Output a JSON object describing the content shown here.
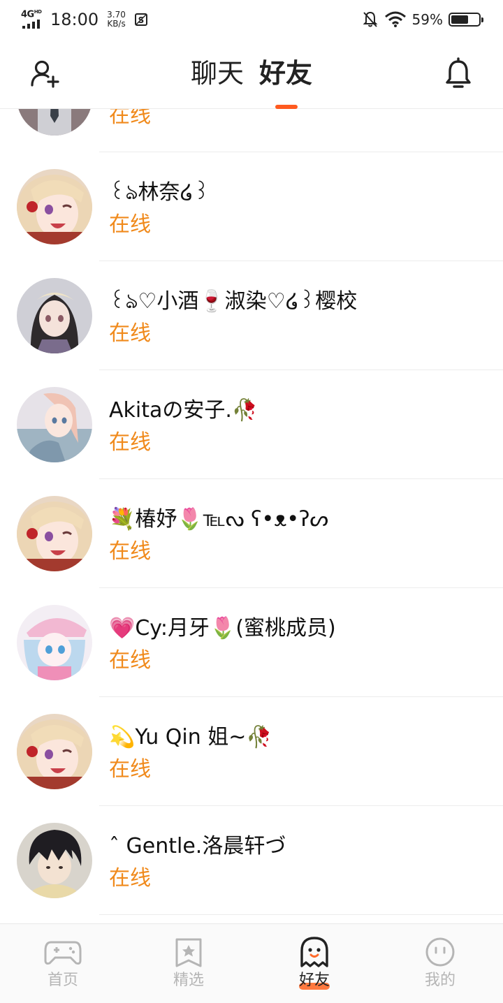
{
  "status_bar": {
    "network_type": "4G",
    "network_sup": "HD",
    "time": "18:00",
    "speed_value": "3.70",
    "speed_unit": "KB/s",
    "battery_percent": "59%",
    "battery_level": 0.59
  },
  "header": {
    "tabs": [
      {
        "label": "聊天",
        "active": false
      },
      {
        "label": "好友",
        "active": true
      }
    ],
    "accent_color": "#ff5a1f"
  },
  "friends": [
    {
      "name": "",
      "status": "在线",
      "avatar": "avatar-dark-outfit"
    },
    {
      "name": "꒰ঌ林奈໒꒱",
      "status": "在线",
      "avatar": "avatar-blonde-girl"
    },
    {
      "name": "꒰ঌ♡小酒🍷淑染♡໒꒱樱校",
      "status": "在线",
      "avatar": "avatar-dark-hair-girl"
    },
    {
      "name": "Akitaの安子.🥀",
      "status": "在线",
      "avatar": "avatar-pink-hair-girl"
    },
    {
      "name": "💐椿妤🌷℡ᔓ ʕ•ᴥ•ʔᔕ",
      "status": "在线",
      "avatar": "avatar-blonde-girl"
    },
    {
      "name": "💗Cy:月牙🌷(蜜桃成员)",
      "status": "在线",
      "avatar": "avatar-blue-hair-girl"
    },
    {
      "name": "💫Yu Qin 姐~🥀",
      "status": "在线",
      "avatar": "avatar-blonde-girl"
    },
    {
      "name": "ˆ Gentle.洛晨轩づ",
      "status": "在线",
      "avatar": "avatar-dark-hair-boy"
    }
  ],
  "status_color": "#f08a1c",
  "bottom_nav": {
    "items": [
      {
        "label": "首页",
        "icon": "gamepad-icon",
        "active": false
      },
      {
        "label": "精选",
        "icon": "star-bookmark-icon",
        "active": false
      },
      {
        "label": "好友",
        "icon": "ghost-icon",
        "active": true
      },
      {
        "label": "我的",
        "icon": "face-icon",
        "active": false
      }
    ]
  }
}
